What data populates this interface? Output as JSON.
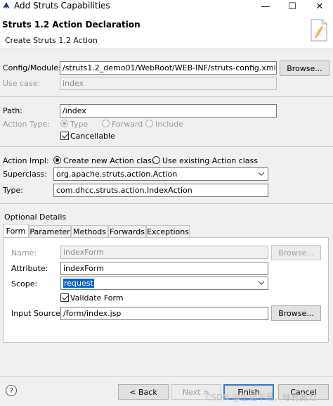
{
  "window": {
    "title": "Add Struts Capabilities",
    "controls": {
      "minimize": "—",
      "maximize": "☐",
      "close": "✕"
    }
  },
  "header": {
    "title": "Struts 1.2 Action Declaration",
    "subtitle": "Create Struts 1.2 Action"
  },
  "config": {
    "label": "Config/Module:",
    "value": "/struts1.2_demo01/WebRoot/WEB-INF/struts-config.xml",
    "browse": "Browse..."
  },
  "use_case": {
    "label": "Use case:",
    "value": "index"
  },
  "path": {
    "label": "Path:",
    "value": "/index"
  },
  "action_type": {
    "label": "Action Type:",
    "options": [
      "Type",
      "Forward",
      "Include"
    ],
    "selected": "Type",
    "cancellable_label": "Cancellable",
    "cancellable_checked": true
  },
  "action_impl": {
    "label": "Action Impl:",
    "options": [
      "Create new Action class",
      "Use existing Action class"
    ],
    "selected": "Create new Action class"
  },
  "superclass": {
    "label": "Superclass:",
    "value": "org.apache.struts.action.Action"
  },
  "type": {
    "label": "Type:",
    "value": "com.dhcc.struts.action.IndexAction"
  },
  "optional": {
    "label": "Optional Details",
    "tabs": [
      "Form",
      "Parameter",
      "Methods",
      "Forwards",
      "Exceptions"
    ],
    "active_tab": "Form",
    "form": {
      "name_label": "Name:",
      "name_value": "indexForm",
      "name_browse": "Browse...",
      "attribute_label": "Attribute:",
      "attribute_value": "indexForm",
      "scope_label": "Scope:",
      "scope_value": "request",
      "validate_label": "Validate Form",
      "validate_checked": true,
      "input_label": "Input Source:",
      "input_value": "/form/index.jsp",
      "input_browse": "Browse..."
    }
  },
  "footer": {
    "help": "?",
    "back": "< Back",
    "next": "Next >",
    "finish": "Finish",
    "cancel": "Cancel"
  },
  "watermark": "CSDN @生活不易，唯有努力"
}
